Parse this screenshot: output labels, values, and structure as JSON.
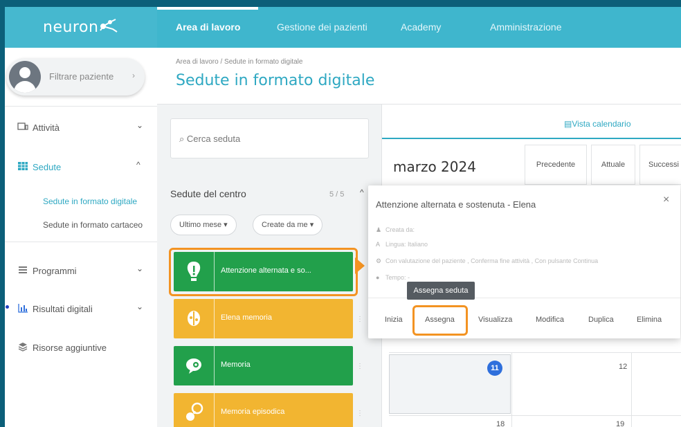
{
  "app": {
    "logo": "neuron"
  },
  "nav": {
    "tabs": [
      {
        "label": "Area di lavoro"
      },
      {
        "label": "Gestione dei pazienti"
      },
      {
        "label": "Academy"
      },
      {
        "label": "Amministrazione"
      }
    ]
  },
  "sidebar": {
    "patient_filter": "Filtrare paziente",
    "items": [
      {
        "label": "Attività",
        "icon": "activity-icon"
      },
      {
        "label": "Sedute",
        "icon": "grid-icon"
      },
      {
        "label": "Programmi",
        "icon": "list-icon"
      },
      {
        "label": "Risultati digitali",
        "icon": "bar-chart-icon"
      },
      {
        "label": "Risorse aggiuntive",
        "icon": "resources-icon"
      }
    ],
    "sub_items": [
      {
        "label": "Sedute in formato digitale"
      },
      {
        "label": "Sedute in formato cartaceo"
      }
    ]
  },
  "header": {
    "breadcrumb": "Area di lavoro  /  Sedute in formato digitale",
    "title": "Sedute in formato digitale"
  },
  "list": {
    "search_placeholder": "Cerca seduta",
    "heading": "Sedute del centro",
    "count": "5 / 5",
    "filters": [
      "Ultimo mese",
      "Create da me"
    ],
    "sessions": [
      {
        "label": "Attenzione alternata e so...",
        "color": "#22a04b"
      },
      {
        "label": "Elena memoria",
        "color": "#f2b531"
      },
      {
        "label": "Memoria",
        "color": "#22a04b"
      },
      {
        "label": "Memoria episodica",
        "color": "#f2b531"
      }
    ]
  },
  "calendar": {
    "view_label": "Vista calendario",
    "month": "marzo 2024",
    "buttons": [
      "Precedente",
      "Attuale",
      "Successi"
    ],
    "days": [
      "11",
      "12",
      "18",
      "19"
    ]
  },
  "popup": {
    "title": "Attenzione alternata e sostenuta - Elena",
    "close": "×",
    "lines": [
      "Creata da:",
      "Lingua: Italiano",
      "Con valutazione del paziente , Conferma fine attività , Con pulsante Continua",
      "Tempo: -"
    ],
    "tooltip": "Assegna seduta",
    "actions": [
      "Inizia",
      "Assegna",
      "Visualizza",
      "Modifica",
      "Duplica",
      "Elimina"
    ]
  },
  "colors": {
    "accent": "#2ea8c2",
    "highlight": "#f39322",
    "green": "#22a04b",
    "yellow": "#f2b531"
  }
}
